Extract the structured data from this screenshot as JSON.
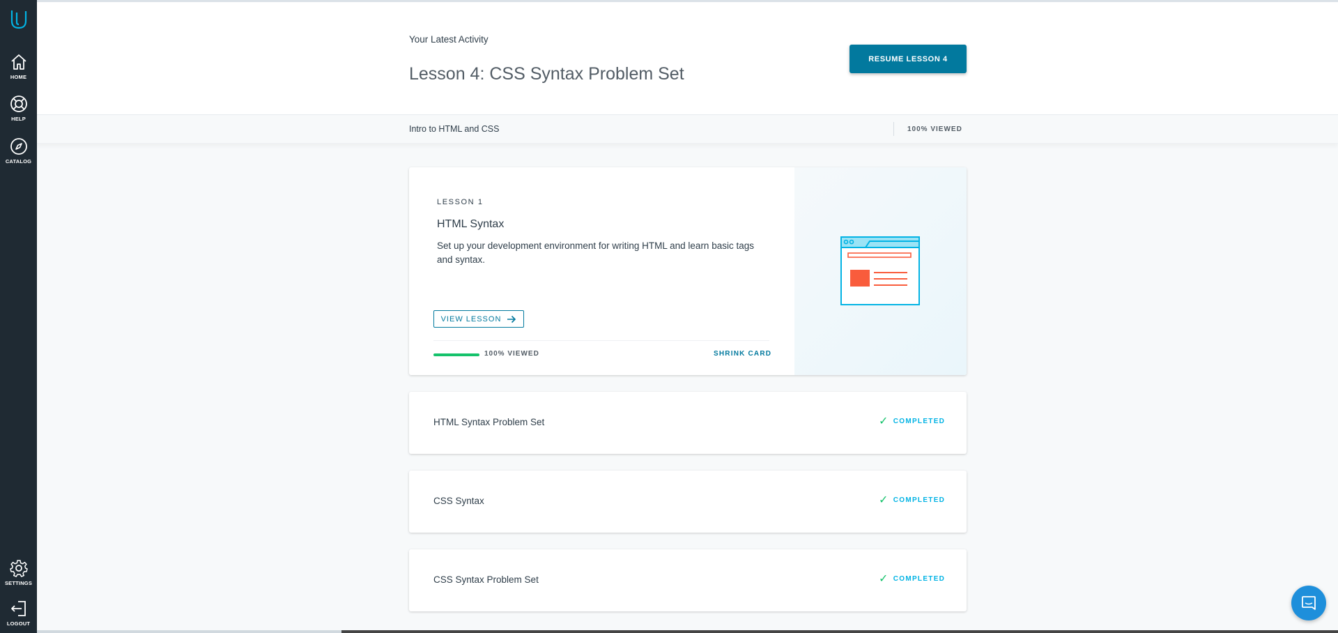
{
  "sidebar": {
    "items": [
      {
        "label": "HOME",
        "icon": "home-icon"
      },
      {
        "label": "HELP",
        "icon": "help-icon"
      },
      {
        "label": "CATALOG",
        "icon": "compass-icon"
      },
      {
        "label": "SETTINGS",
        "icon": "gear-icon"
      },
      {
        "label": "LOGOUT",
        "icon": "logout-icon"
      }
    ]
  },
  "header": {
    "latest_label": "Your Latest Activity",
    "lesson_title": "Lesson 4: CSS Syntax Problem Set",
    "resume_button": "RESUME LESSON 4"
  },
  "course": {
    "name": "Intro to HTML and CSS",
    "viewed": "100% VIEWED"
  },
  "lesson_card": {
    "kicker": "LESSON 1",
    "title": "HTML Syntax",
    "description": "Set up your development environment for writing HTML and learn basic tags and syntax.",
    "view_button": "VIEW LESSON",
    "progress_percent": 100,
    "progress_text": "100% VIEWED",
    "shrink_label": "SHRINK CARD"
  },
  "lessons": [
    {
      "title": "HTML Syntax Problem Set",
      "status": "COMPLETED"
    },
    {
      "title": "CSS Syntax",
      "status": "COMPLETED"
    },
    {
      "title": "CSS Syntax Problem Set",
      "status": "COMPLETED"
    }
  ],
  "colors": {
    "sidebar": "#1f2a33",
    "accent": "#02799e",
    "progress": "#15c26b",
    "completed": "#02b3e4",
    "illustration_stroke": "#02b3e4",
    "illustration_red": "#f95c3c"
  }
}
